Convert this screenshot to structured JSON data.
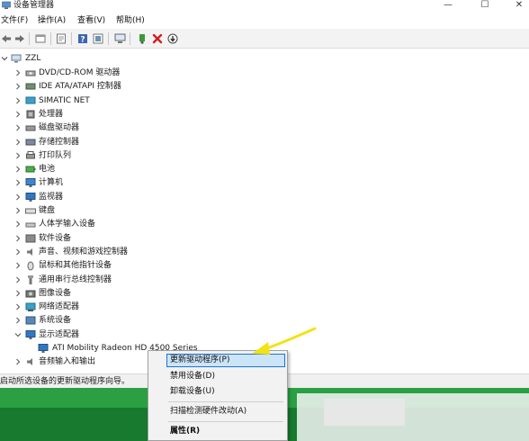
{
  "window": {
    "title": "设备管理器",
    "minimize_glyph": "—",
    "maximize_glyph": "☐",
    "close_glyph": "✕"
  },
  "menu": [
    "文件(F)",
    "操作(A)",
    "查看(V)",
    "帮助(H)"
  ],
  "toolbar_icons": [
    "back-icon",
    "forward-icon",
    "show-hide-icon",
    "properties-icon",
    "help-icon",
    "computer-icon",
    "add-driver-icon",
    "uninstall-icon",
    "download-icon"
  ],
  "tree": {
    "root": "ZZL",
    "items": [
      {
        "label": "DVD/CD-ROM 驱动器",
        "icon": "dvd-drive-icon"
      },
      {
        "label": "IDE ATA/ATAPI 控制器",
        "icon": "ide-controller-icon"
      },
      {
        "label": "SIMATIC NET",
        "icon": "network-icon"
      },
      {
        "label": "处理器",
        "icon": "processor-icon"
      },
      {
        "label": "磁盘驱动器",
        "icon": "disk-drive-icon"
      },
      {
        "label": "存储控制器",
        "icon": "storage-controller-icon"
      },
      {
        "label": "打印队列",
        "icon": "printer-icon"
      },
      {
        "label": "电池",
        "icon": "battery-icon"
      },
      {
        "label": "计算机",
        "icon": "computer-icon"
      },
      {
        "label": "监视器",
        "icon": "monitor-icon"
      },
      {
        "label": "键盘",
        "icon": "keyboard-icon"
      },
      {
        "label": "人体学输入设备",
        "icon": "hid-icon"
      },
      {
        "label": "软件设备",
        "icon": "software-device-icon"
      },
      {
        "label": "声音、视频和游戏控制器",
        "icon": "sound-icon"
      },
      {
        "label": "鼠标和其他指针设备",
        "icon": "mouse-icon"
      },
      {
        "label": "通用串行总线控制器",
        "icon": "usb-icon"
      },
      {
        "label": "图像设备",
        "icon": "camera-icon"
      },
      {
        "label": "网络适配器",
        "icon": "network-adapter-icon"
      },
      {
        "label": "系统设备",
        "icon": "system-device-icon"
      },
      {
        "label": "显示适配器",
        "icon": "display-adapter-icon",
        "expanded": true
      },
      {
        "label": "ATI Mobility Radeon HD 4500 Series",
        "icon": "display-device-icon",
        "child": true
      },
      {
        "label": "音频输入和输出",
        "icon": "audio-icon"
      }
    ]
  },
  "status": "启动所选设备的更新驱动程序向导。",
  "context_menu": {
    "items": [
      {
        "label": "更新驱动程序(P)",
        "highlighted": true
      },
      {
        "label": "禁用设备(D)"
      },
      {
        "label": "卸载设备(U)"
      },
      {
        "label": "扫描检测硬件改动(A)"
      },
      {
        "label": "属性(R)",
        "bold": true
      }
    ]
  },
  "colors": {
    "highlight_bg": "#cce4f7",
    "highlight_border": "#1874d2",
    "arrow": "#f2e21a"
  }
}
